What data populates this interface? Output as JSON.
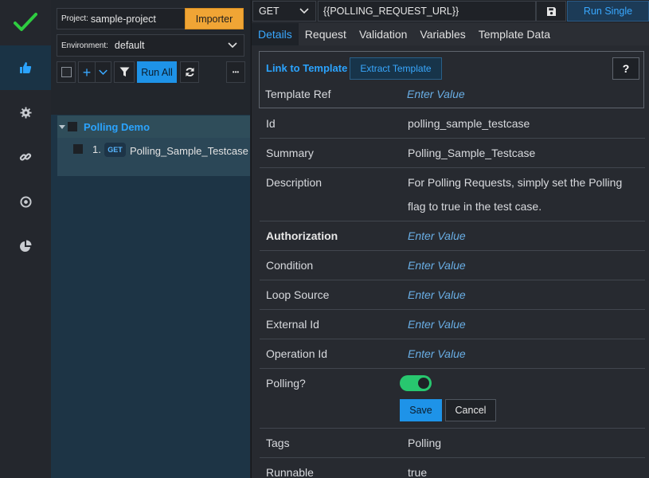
{
  "sidebar": {
    "icons": [
      "checkmark-logo",
      "thumbs-up-icon",
      "gear-icon",
      "link-icon",
      "target-icon",
      "pie-chart-icon"
    ],
    "accent_color": "#2ecc40"
  },
  "explorer": {
    "project_label": "Project:",
    "project_value": "sample-project",
    "importer_label": "Importer",
    "environment_label": "Environment:",
    "environment_value": "default",
    "add_label": "+",
    "run_all_label": "Run All",
    "more_label": "•••",
    "group_name": "Polling Demo",
    "testcase": {
      "index": "1.",
      "method": "GET",
      "name": "Polling_Sample_Testcase"
    }
  },
  "request": {
    "method": "GET",
    "url": "{{POLLING_REQUEST_URL}}",
    "run_single_label": "Run Single"
  },
  "tabs": [
    {
      "label": "Details",
      "active": true
    },
    {
      "label": "Request",
      "active": false
    },
    {
      "label": "Validation",
      "active": false
    },
    {
      "label": "Variables",
      "active": false
    },
    {
      "label": "Template Data",
      "active": false
    }
  ],
  "template": {
    "link_label": "Link to Template",
    "extract_label": "Extract Template",
    "help_label": "?",
    "ref_label": "Template Ref",
    "ref_placeholder": "Enter Value"
  },
  "fields": {
    "id": {
      "label": "Id",
      "value": "polling_sample_testcase"
    },
    "summary": {
      "label": "Summary",
      "value": "Polling_Sample_Testcase"
    },
    "description": {
      "label": "Description",
      "line1": "For Polling Requests, simply set the Polling",
      "line2": "flag to true in the test case."
    },
    "authorization": {
      "label": "Authorization",
      "placeholder": "Enter Value"
    },
    "condition": {
      "label": "Condition",
      "placeholder": "Enter Value"
    },
    "loop_source": {
      "label": "Loop Source",
      "placeholder": "Enter Value"
    },
    "external_id": {
      "label": "External Id",
      "placeholder": "Enter Value"
    },
    "operation_id": {
      "label": "Operation Id",
      "placeholder": "Enter Value"
    },
    "polling": {
      "label": "Polling?",
      "enabled": true,
      "save_label": "Save",
      "cancel_label": "Cancel"
    },
    "tags": {
      "label": "Tags",
      "value": "Polling"
    },
    "runnable": {
      "label": "Runnable",
      "value": "true"
    }
  }
}
